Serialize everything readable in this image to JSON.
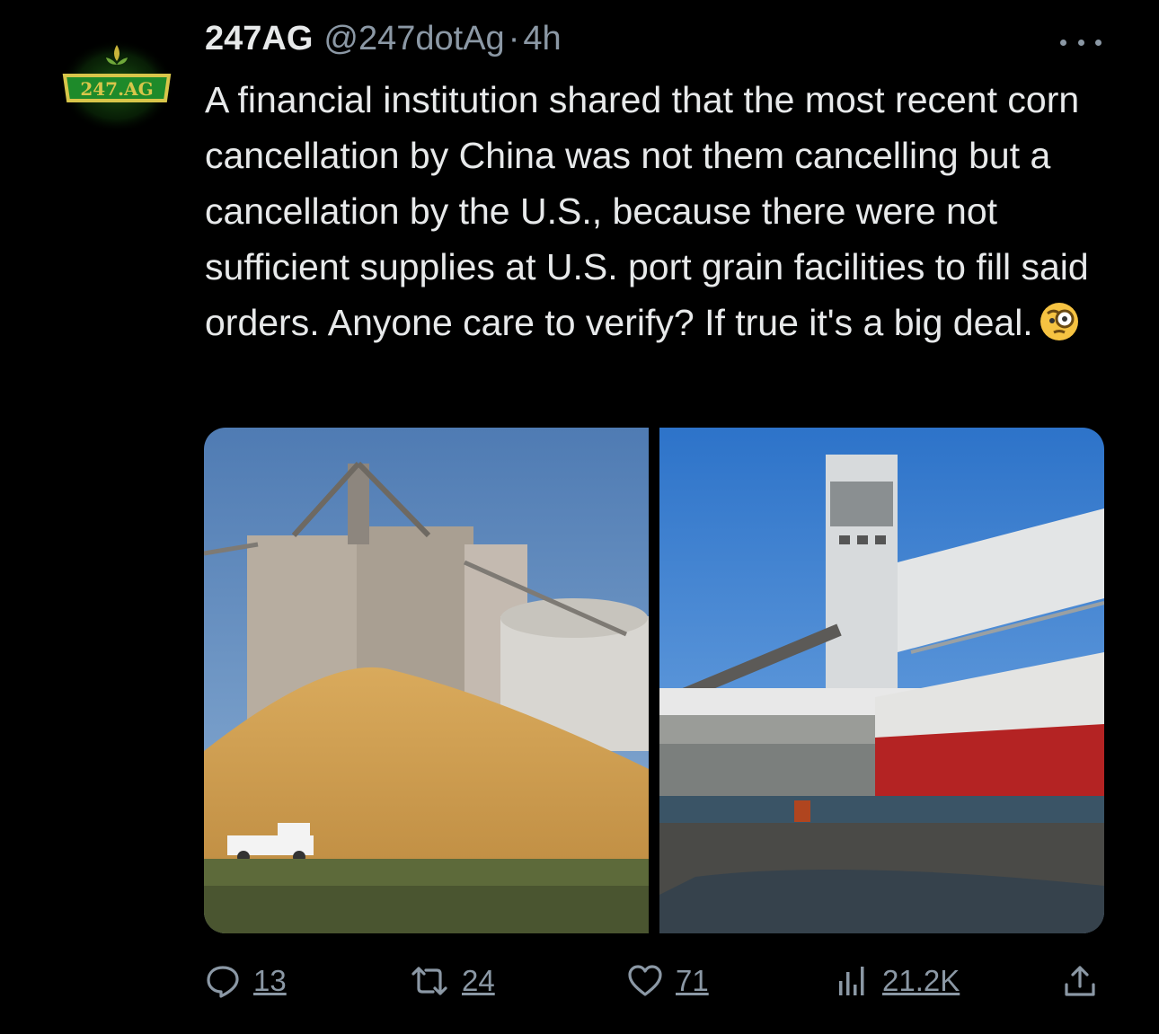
{
  "tweet": {
    "avatar_text": "247.AG",
    "display_name": "247AG",
    "handle": "@247dotAg",
    "separator": "·",
    "timestamp": "4h",
    "text": "A financial institution shared that the most recent corn cancellation by China was not them cancelling but a cancellation by the U.S., because there were not sufficient supplies at U.S. port grain facilities to fill said orders. Anyone care to verify? If true it's a big deal.",
    "emoji": "face-with-monocle"
  },
  "media": [
    {
      "description_icon": "grain-silo-photo"
    },
    {
      "description_icon": "port-ship-photo"
    }
  ],
  "actions": {
    "replies": "13",
    "reposts": "24",
    "likes": "71",
    "views": "21.2K"
  },
  "colors": {
    "background": "#000000",
    "text": "#e7e9ea",
    "secondary": "#8b98a5",
    "avatar_green": "#1f7a1f",
    "avatar_gold": "#d8c64a"
  }
}
